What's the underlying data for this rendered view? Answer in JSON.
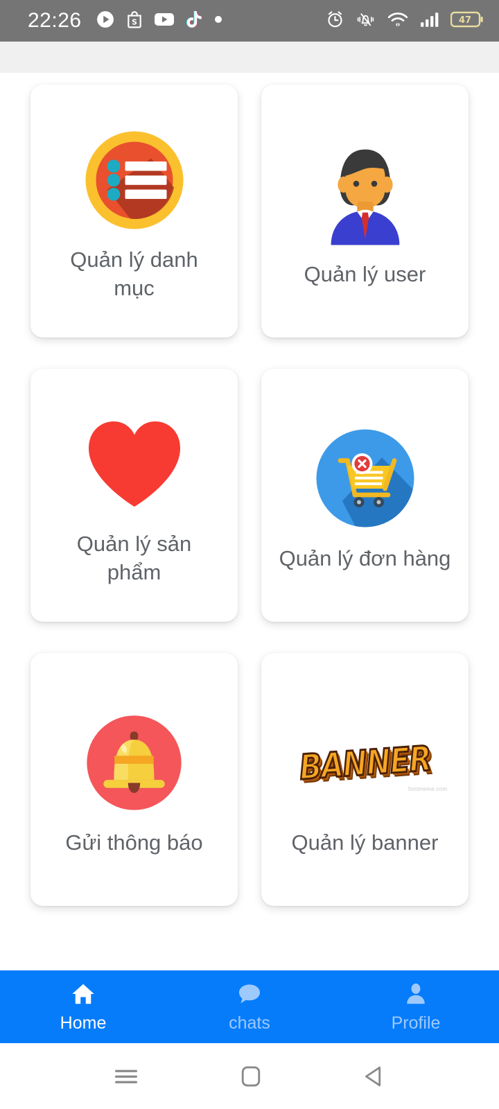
{
  "status_bar": {
    "time": "22:26",
    "left_icons": [
      {
        "name": "play-store-icon"
      },
      {
        "name": "shopee-icon"
      },
      {
        "name": "youtube-icon"
      },
      {
        "name": "tiktok-icon"
      },
      {
        "name": "notification-dot-icon"
      }
    ],
    "right_icons": [
      {
        "name": "alarm-clock-icon"
      },
      {
        "name": "bell-muted-icon"
      },
      {
        "name": "wifi-icon"
      },
      {
        "name": "cellular-signal-icon"
      }
    ],
    "battery_level": "47",
    "background_color": "#757575"
  },
  "app_bar": {
    "background_color": "#f0f0f0"
  },
  "menu": {
    "cards": [
      {
        "label": "Quản lý danh mục",
        "icon": "category-list-icon"
      },
      {
        "label": "Quản lý user",
        "icon": "businessman-avatar-icon"
      },
      {
        "label": "Quản lý sản phẩm",
        "icon": "heart-icon"
      },
      {
        "label": "Quản lý đơn hàng",
        "icon": "shopping-cart-remove-icon"
      },
      {
        "label": "Gửi thông báo",
        "icon": "bell-notification-icon"
      },
      {
        "label": "Quản lý banner",
        "icon": "banner-wordart-icon",
        "art_text": "BANNER",
        "art_watermark": "fontmeme.com"
      }
    ],
    "label_color": "#5f6368"
  },
  "bottom_nav": {
    "background_color": "#067cfb",
    "active_color": "#ffffff",
    "inactive_color": "#9ec9fd",
    "items": [
      {
        "label": "Home",
        "icon": "home-icon",
        "active": true
      },
      {
        "label": "chats",
        "icon": "chat-bubble-icon",
        "active": false
      },
      {
        "label": "Profile",
        "icon": "person-icon",
        "active": false
      }
    ]
  },
  "system_nav": {
    "buttons": [
      {
        "name": "recents-button",
        "icon": "hamburger-icon"
      },
      {
        "name": "home-button",
        "icon": "rounded-square-icon"
      },
      {
        "name": "back-button",
        "icon": "triangle-left-icon"
      }
    ]
  }
}
